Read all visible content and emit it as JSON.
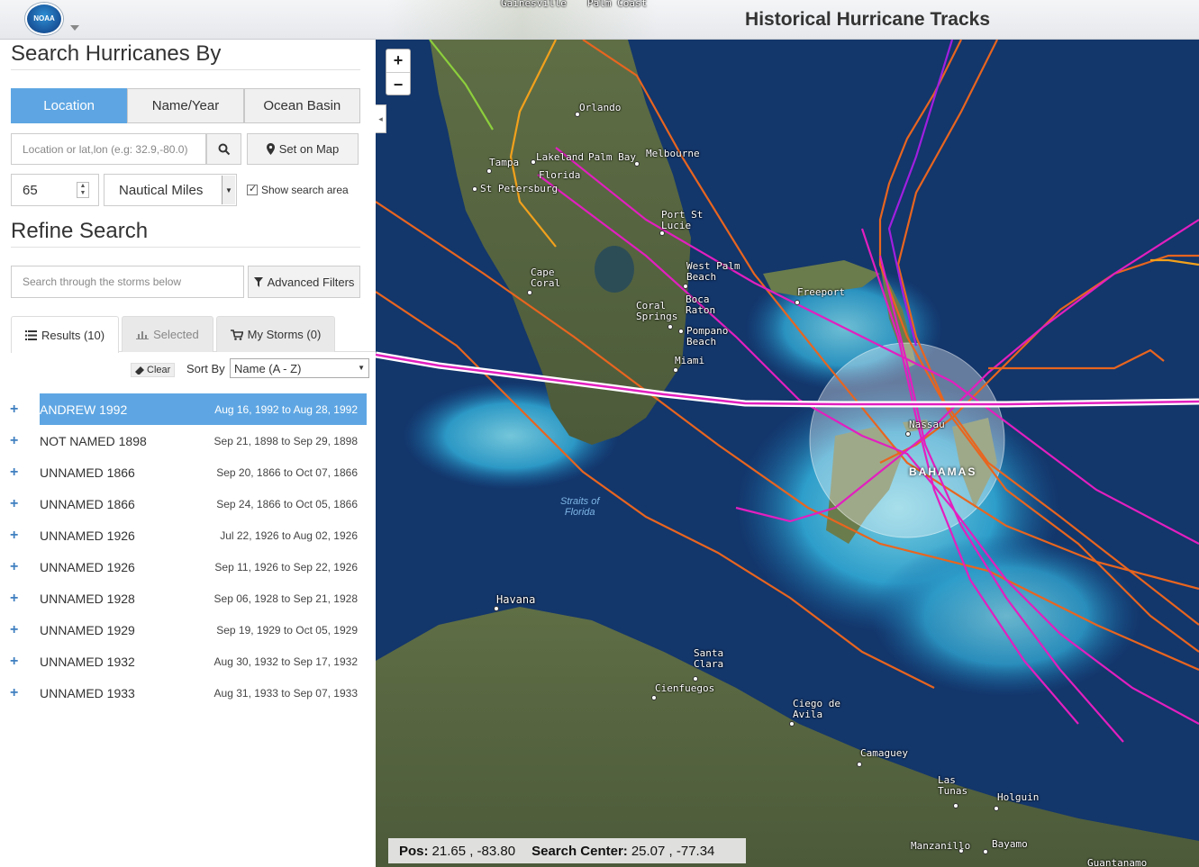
{
  "header": {
    "title": "Historical Hurricane Tracks",
    "logo_text": "NOAA"
  },
  "sidebar": {
    "search_title": "Search Hurricanes By",
    "search_tabs": [
      {
        "label": "Location",
        "active": true
      },
      {
        "label": "Name/Year",
        "active": false
      },
      {
        "label": "Ocean Basin",
        "active": false
      }
    ],
    "location_placeholder": "Location or lat,lon (e.g: 32.9,-80.0)",
    "set_on_map_label": "Set on Map",
    "radius_value": "65",
    "radius_unit": "Nautical Miles",
    "show_search_area_label": "Show search area",
    "show_search_area_checked": true,
    "refine_title": "Refine Search",
    "refine_placeholder": "Search through the storms below",
    "advanced_filters_label": "Advanced Filters",
    "result_tabs": [
      {
        "label": "Results (10)",
        "active": true
      },
      {
        "label": "Selected",
        "active": false
      },
      {
        "label": "My Storms (0)",
        "active": false
      }
    ],
    "clear_label": "Clear",
    "sort_by_label": "Sort By",
    "sort_option": "Name (A - Z)",
    "storms": [
      {
        "name": "ANDREW 1992",
        "dates": "Aug 16, 1992 to Aug 28, 1992",
        "selected": true
      },
      {
        "name": "NOT NAMED 1898",
        "dates": "Sep 21, 1898 to Sep 29, 1898",
        "selected": false
      },
      {
        "name": "UNNAMED 1866",
        "dates": "Sep 20, 1866 to Oct 07, 1866",
        "selected": false
      },
      {
        "name": "UNNAMED 1866",
        "dates": "Sep 24, 1866 to Oct 05, 1866",
        "selected": false
      },
      {
        "name": "UNNAMED 1926",
        "dates": "Jul 22, 1926 to Aug 02, 1926",
        "selected": false
      },
      {
        "name": "UNNAMED 1926",
        "dates": "Sep 11, 1926 to Sep 22, 1926",
        "selected": false
      },
      {
        "name": "UNNAMED 1928",
        "dates": "Sep 06, 1928 to Sep 21, 1928",
        "selected": false
      },
      {
        "name": "UNNAMED 1929",
        "dates": "Sep 19, 1929 to Oct 05, 1929",
        "selected": false
      },
      {
        "name": "UNNAMED 1932",
        "dates": "Aug 30, 1932 to Sep 17, 1932",
        "selected": false
      },
      {
        "name": "UNNAMED 1933",
        "dates": "Aug 31, 1933 to Sep 07, 1933",
        "selected": false
      }
    ]
  },
  "map": {
    "zoom_in": "+",
    "zoom_out": "−",
    "collapse_glyph": "◂",
    "header_places": [
      "Gainesville",
      "Palm Coast"
    ],
    "cities": {
      "orlando": "Orlando",
      "tampa": "Tampa",
      "lakeland": "Lakeland",
      "palm_bay": "Palm Bay",
      "melbourne": "Melbourne",
      "florida": "Florida",
      "st_petersburg": "St Petersburg",
      "port_st_lucie": "Port St\nLucie",
      "west_palm_beach": "West Palm\nBeach",
      "freeport": "Freeport",
      "cape_coral": "Cape\nCoral",
      "coral_springs": "Coral\nSprings",
      "boca_raton": "Boca\nRaton",
      "pompano_beach": "Pompano\nBeach",
      "miami": "Miami",
      "nassau": "Nassau",
      "havana": "Havana",
      "santa_clara": "Santa\nClara",
      "cienfuegos": "Cienfuegos",
      "ciego_de_avila": "Ciego de\nAvila",
      "camaguey": "Camaguey",
      "las_tunas": "Las\nTunas",
      "holguin": "Holguin",
      "manzanillo": "Manzanillo",
      "bayamo": "Bayamo",
      "guantanamo": "Guantanamo"
    },
    "sea_label": "Straits of\nFlorida",
    "country_label": "BAHAMAS",
    "track_colors": [
      "#e8651f",
      "#e21fbf",
      "#a01fe0",
      "#f2a11c",
      "#8ccf3c"
    ],
    "status": {
      "pos_label": "Pos:",
      "pos_value": "21.65 , -83.80",
      "center_label": "Search Center:",
      "center_value": "25.07 , -77.34"
    }
  }
}
